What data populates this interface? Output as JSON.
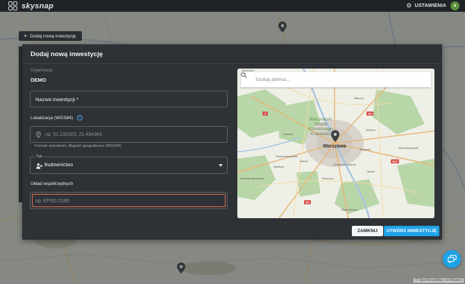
{
  "app": {
    "logo_text": "skysnap"
  },
  "header": {
    "settings_label": "USTAWIENIA",
    "avatar_initials": "A"
  },
  "background": {
    "add_button_label": "Dodaj nową inwestycję",
    "attribution": "© OpenStreetMap contributors"
  },
  "modal": {
    "title": "Dodaj nową inwestycję",
    "organization_label": "Organizacja",
    "organization_value": "DEMO",
    "name_field_label": "Nazwa inwestycji *",
    "location_label": "Lokalizacja (WGS84)",
    "location_placeholder": "np. 51.232323, 21.434343",
    "location_hint": "Format: szerokość, długość geograficzna (WGS84)",
    "type_legend": "Typ",
    "type_value": "Budownictwo",
    "coord_system_label": "Układ współrzędnych",
    "coord_system_placeholder": "np. EPSG:2180",
    "map_search_placeholder": "Szukaj adresu...",
    "close_button": "ZAMKNIJ",
    "create_button": "UTWÓRZ INWESTYCJĘ"
  },
  "map": {
    "labels": {
      "city": "Warszawa",
      "park": [
        "Warszawski",
        "Obszar",
        "Chronionego",
        "Krajobrazu"
      ],
      "small": [
        "Zakroczym",
        "Łomianki",
        "Ożarów Mazowiecki",
        "Grodzisk Mazowiecki",
        "Piaseczno",
        "Góra Kalwaria",
        "Mińsk Mazowiecki",
        "Otwock",
        "Nieporęt",
        "Radzymin",
        "Wołomin",
        "Sulejówek",
        "Nadarzyn",
        "Raszyn",
        "Konstancin-Jeziorna"
      ]
    },
    "road_badges": [
      "S17",
      "7",
      "S8",
      "S2"
    ]
  },
  "colors": {
    "accent": "#1fa3e7",
    "focus_border": "#e8714f",
    "modal_bg": "#2e3236",
    "topbar_bg": "#1f2327"
  }
}
